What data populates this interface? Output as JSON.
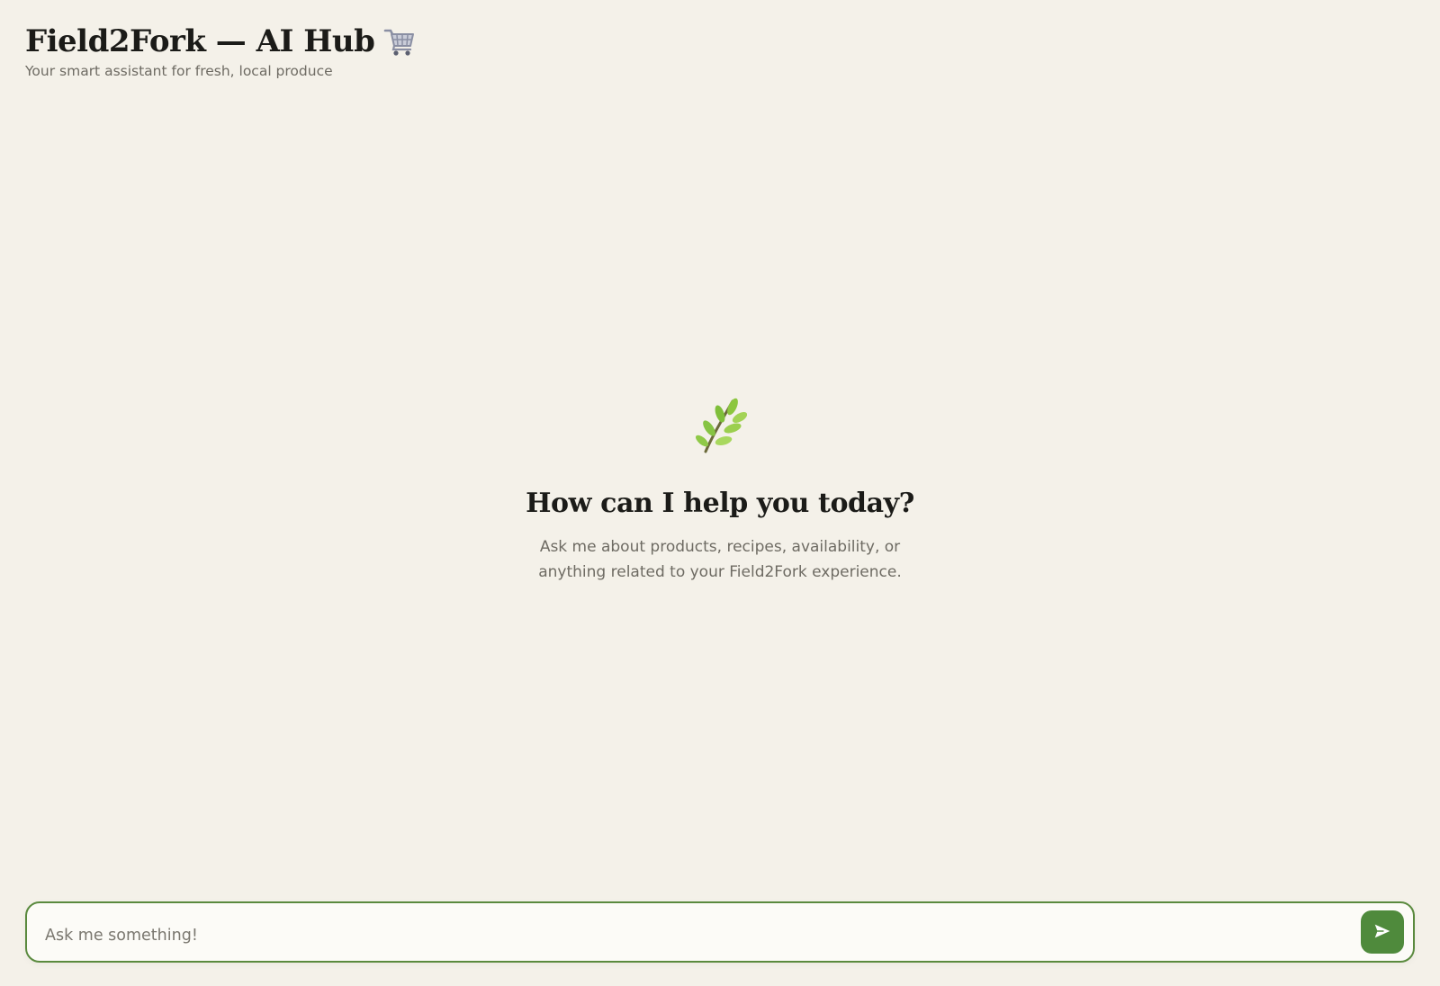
{
  "header": {
    "title": "Field2Fork — AI Hub",
    "title_icon": "shopping-cart-icon",
    "subtitle": "Your smart assistant for fresh, local produce"
  },
  "empty_state": {
    "icon": "herb-leaf-icon",
    "title": "How can I help you today?",
    "text": "Ask me about products, recipes, availability, or anything related to your Field2Fork experience."
  },
  "composer": {
    "placeholder": "Ask me something!",
    "value": "",
    "send_icon": "send-icon"
  },
  "colors": {
    "background": "#f4f1e9",
    "accent": "#4f8a3c",
    "border": "#5a8a3e",
    "heading": "#1b1b18",
    "muted": "#6e6b63"
  }
}
